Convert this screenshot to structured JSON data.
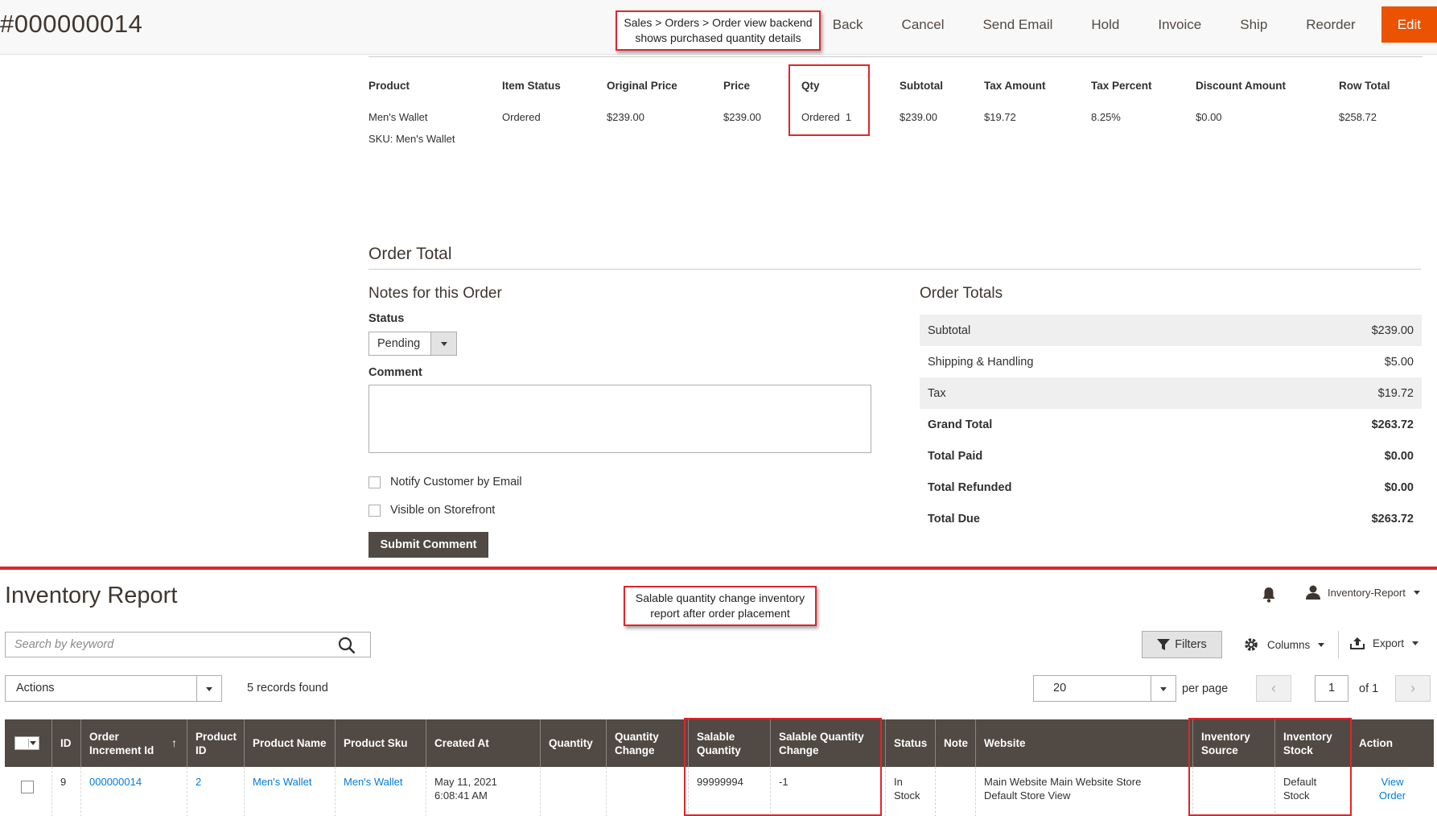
{
  "order_header": {
    "title": "#000000014",
    "actions": [
      "Back",
      "Cancel",
      "Send Email",
      "Hold",
      "Invoice",
      "Ship",
      "Reorder"
    ],
    "edit_label": "Edit"
  },
  "callouts": {
    "order_view": "Sales > Orders > Order view backend shows purchased quantity details",
    "inventory": "Salable quantity change inventory report after order placement"
  },
  "items_ordered": {
    "headers": [
      "Product",
      "Item Status",
      "Original Price",
      "Price",
      "Qty",
      "Subtotal",
      "Tax Amount",
      "Tax Percent",
      "Discount Amount",
      "Row Total"
    ],
    "row": {
      "product": "Men's Wallet",
      "sku": "SKU: Men's Wallet",
      "item_status": "Ordered",
      "original_price": "$239.00",
      "price": "$239.00",
      "qty": "Ordered  1",
      "subtotal": "$239.00",
      "tax_amount": "$19.72",
      "tax_percent": "8.25%",
      "discount_amount": "$0.00",
      "row_total": "$258.72"
    }
  },
  "order_total": {
    "title": "Order Total",
    "notes_title": "Notes for this Order",
    "status_label": "Status",
    "status_value": "Pending",
    "comment_label": "Comment",
    "notify_label": "Notify Customer by Email",
    "visible_label": "Visible on Storefront",
    "submit_label": "Submit Comment"
  },
  "order_totals": {
    "title": "Order Totals",
    "rows": [
      {
        "label": "Subtotal",
        "value": "$239.00"
      },
      {
        "label": "Shipping & Handling",
        "value": "$5.00"
      },
      {
        "label": "Tax",
        "value": "$19.72"
      },
      {
        "label": "Grand Total",
        "value": "$263.72"
      },
      {
        "label": "Total Paid",
        "value": "$0.00"
      },
      {
        "label": "Total Refunded",
        "value": "$0.00"
      },
      {
        "label": "Total Due",
        "value": "$263.72"
      }
    ]
  },
  "inventory_report": {
    "title": "Inventory Report",
    "user": "Inventory-Report",
    "search_placeholder": "Search by keyword",
    "filters_label": "Filters",
    "columns_label": "Columns",
    "export_label": "Export",
    "actions_label": "Actions",
    "records": "5 records found",
    "per_page_value": "20",
    "per_page_label": "per page",
    "page": "1",
    "page_of": "of 1",
    "headers": {
      "id": "ID",
      "order_increment_id": "Order Increment Id",
      "sort_arrow": "↑",
      "product_id": "Product ID",
      "product_name": "Product Name",
      "product_sku": "Product Sku",
      "created_at": "Created At",
      "quantity": "Quantity",
      "quantity_change": "Quantity Change",
      "salable_quantity": "Salable Quantity",
      "salable_quantity_change": "Salable Quantity Change",
      "status": "Status",
      "note": "Note",
      "website": "Website",
      "inventory_source": "Inventory Source",
      "inventory_stock": "Inventory Stock",
      "action": "Action"
    },
    "row": {
      "id": "9",
      "order_increment_id": "000000014",
      "product_id": "2",
      "product_name": "Men's Wallet",
      "product_sku": "Men's Wallet",
      "created_at": "May 11, 2021 6:08:41 AM",
      "quantity": "",
      "quantity_change": "",
      "salable_quantity": "99999994",
      "salable_quantity_change": "-1",
      "status": "In Stock",
      "note": "",
      "website": "Main Website Main Website Store Default Store View",
      "inventory_source": "",
      "inventory_stock": "Default Stock",
      "action": "View Order"
    }
  },
  "colors": {
    "accent": "#eb5202",
    "highlight": "#e0252b",
    "grid_header": "#514943",
    "link": "#007bdb"
  }
}
